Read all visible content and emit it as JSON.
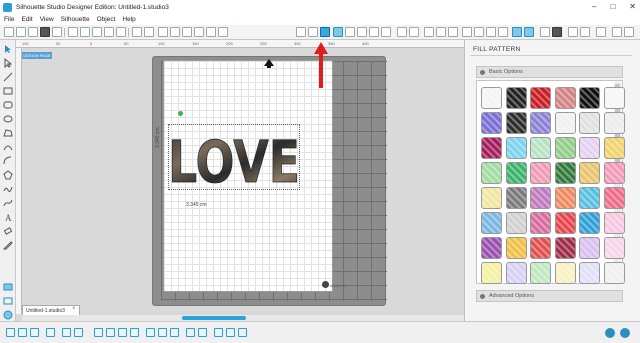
{
  "window": {
    "title": "Silhouette Studio Designer Edition: Untitled-1.studio3",
    "controls": [
      "–",
      "□",
      "✕"
    ]
  },
  "menu": [
    "File",
    "Edit",
    "View",
    "Silhouette",
    "Object",
    "Help"
  ],
  "canvas": {
    "mode_badge": "DESIGN PAGE",
    "ruler_marks": [
      "100",
      "50",
      "0",
      "50",
      "100",
      "150",
      "200",
      "250",
      "300",
      "350",
      "400"
    ],
    "artwork_text": "LOVE",
    "width_readout": "3.345 cm",
    "height_readout": "3.345 cm",
    "mat_brand": "silhouette",
    "tab_label": "Untitled-1.studio3",
    "tab_close": "×"
  },
  "panel": {
    "title": "FILL PATTERN",
    "basic_section": "Basic Options",
    "advanced_section": "Advanced Options",
    "selected_tool": "fill-pattern"
  },
  "colors": {
    "accent": "#2ba4dc",
    "annotation": "#e21b1b",
    "rotate_handle": "#3ab54a"
  },
  "patterns": [
    "#f4f4f4",
    "#222222",
    "#c91c24",
    "#d48282",
    "#111111",
    "#f6f6f6",
    "#7b6cd6",
    "#2c2c2c",
    "#8c80d6",
    "#f0f0f0",
    "#e0e0e0",
    "#ececec",
    "#a51c5a",
    "#7bd3f0",
    "#b6e3c4",
    "#8fcf8a",
    "#e6d0f0",
    "#f2d26a",
    "#a2dba2",
    "#3ab36a",
    "#ef9bb5",
    "#2f7a3a",
    "#e8c46a",
    "#f49ab8",
    "#f0e6a0",
    "#7a7a7a",
    "#c07ac0",
    "#f28a60",
    "#56c0e0",
    "#f06a8a",
    "#7ab6e0",
    "#d0d0d0",
    "#d96aa0",
    "#e8454a",
    "#2ea0d8",
    "#f6c8e0",
    "#9b4fb0",
    "#f0c040",
    "#e05050",
    "#a02a4a",
    "#d8c0f0",
    "#f6d6e8",
    "#f4f0a0",
    "#d8d0f8",
    "#c0e8c0",
    "#f8f0c0",
    "#e0e0f8",
    "#f0f0f0"
  ]
}
